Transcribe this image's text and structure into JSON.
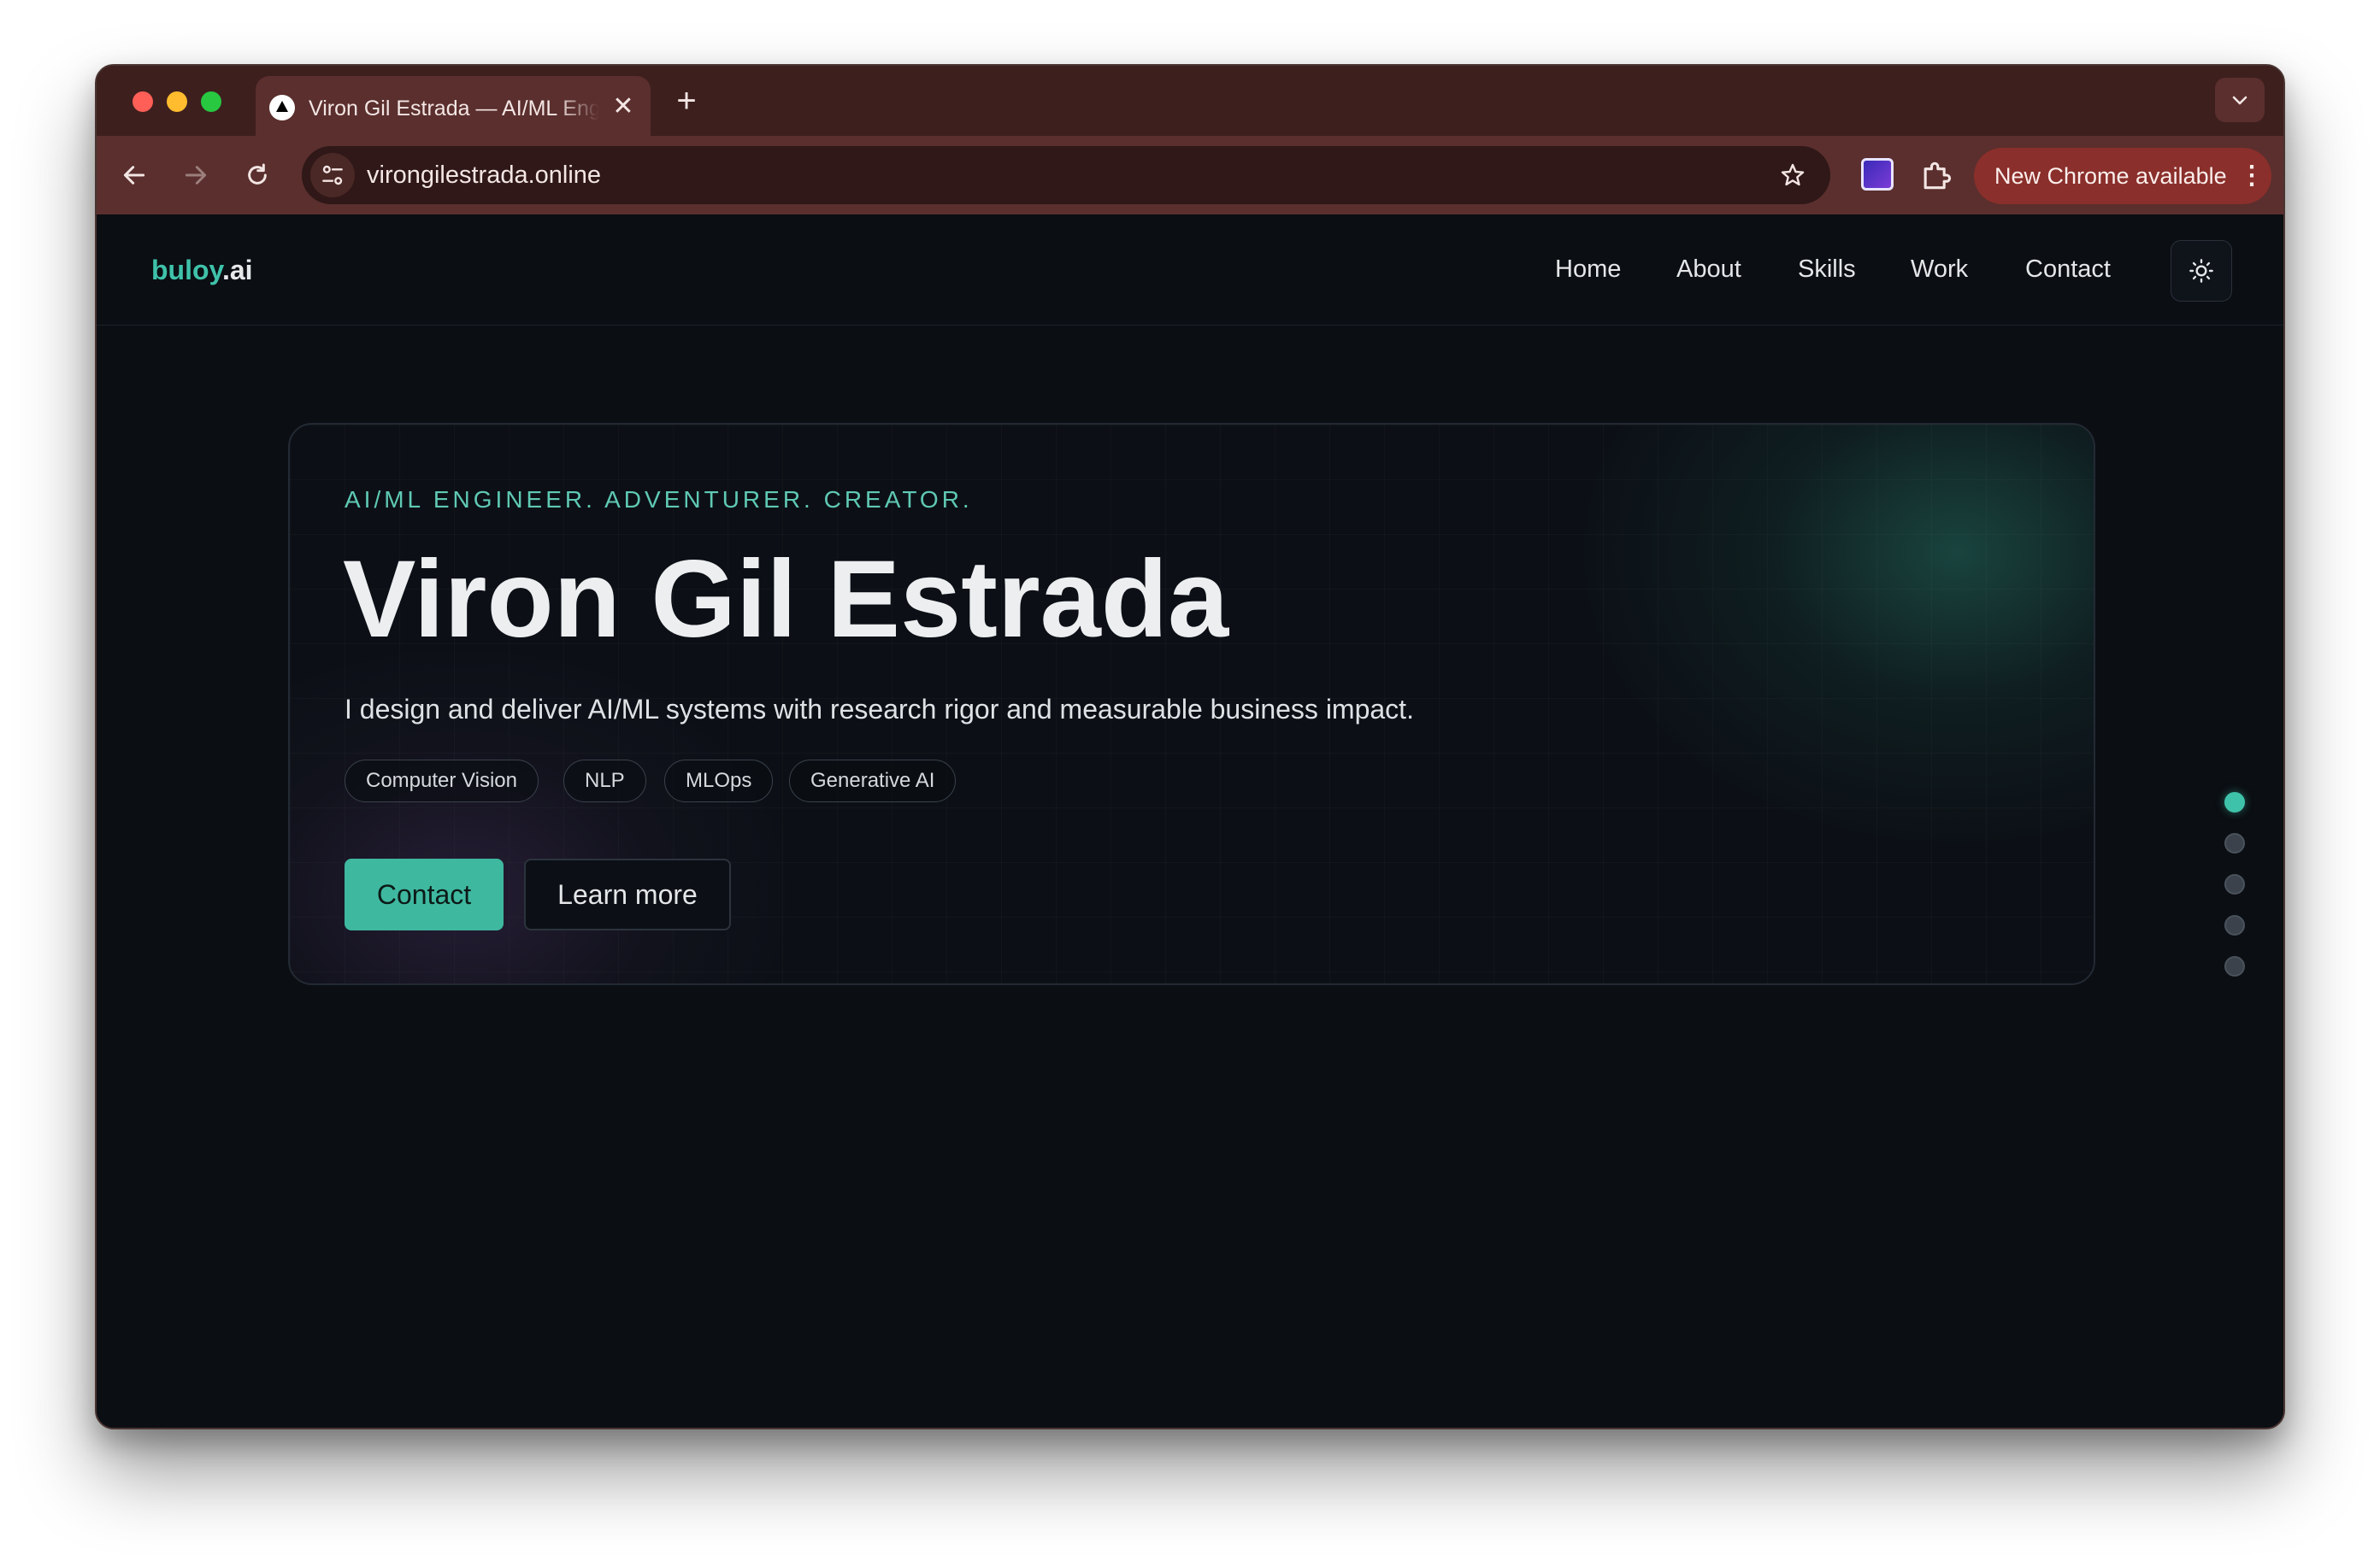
{
  "browser": {
    "tab": {
      "title": "Viron Gil Estrada — AI/ML Engineer",
      "close_glyph": "✕"
    },
    "new_tab_glyph": "+",
    "tab_search_glyph": "⌄",
    "nav": {
      "back_glyph": "←",
      "forward_glyph": "→",
      "reload_glyph": "↻"
    },
    "url": "virongilestrada.online",
    "bookmark_glyph": "☆",
    "update_chip": {
      "label": "New Chrome available",
      "menu_glyph": "⋮"
    },
    "icons": [
      "lock-tune-icon",
      "bookmark-star-icon",
      "extension-app-icon",
      "extensions-puzzle-icon",
      "profile-avatar",
      "more-menu-icon"
    ]
  },
  "site": {
    "brand": {
      "primary": "buloy",
      "suffix": ".ai"
    },
    "nav": [
      {
        "label": "Home"
      },
      {
        "label": "About"
      },
      {
        "label": "Skills"
      },
      {
        "label": "Work"
      },
      {
        "label": "Contact"
      }
    ],
    "theme_toggle_icon": "sun-icon"
  },
  "hero": {
    "eyebrow": "AI/ML ENGINEER. ADVENTURER. CREATOR.",
    "name": "Viron Gil Estrada",
    "description": "I design and deliver AI/ML systems with research rigor and measurable business impact.",
    "tags": [
      "Computer Vision",
      "NLP",
      "MLOps",
      "Generative AI"
    ],
    "primary_button": "Contact",
    "secondary_button": "Learn more"
  },
  "section_dots": {
    "count": 5,
    "active_index": 0
  },
  "colors": {
    "accent": "#3fc2aa",
    "page_background": "#0b0e13",
    "browser_frame": "#5a2f2d",
    "update_chip": "#8a2f2b"
  }
}
